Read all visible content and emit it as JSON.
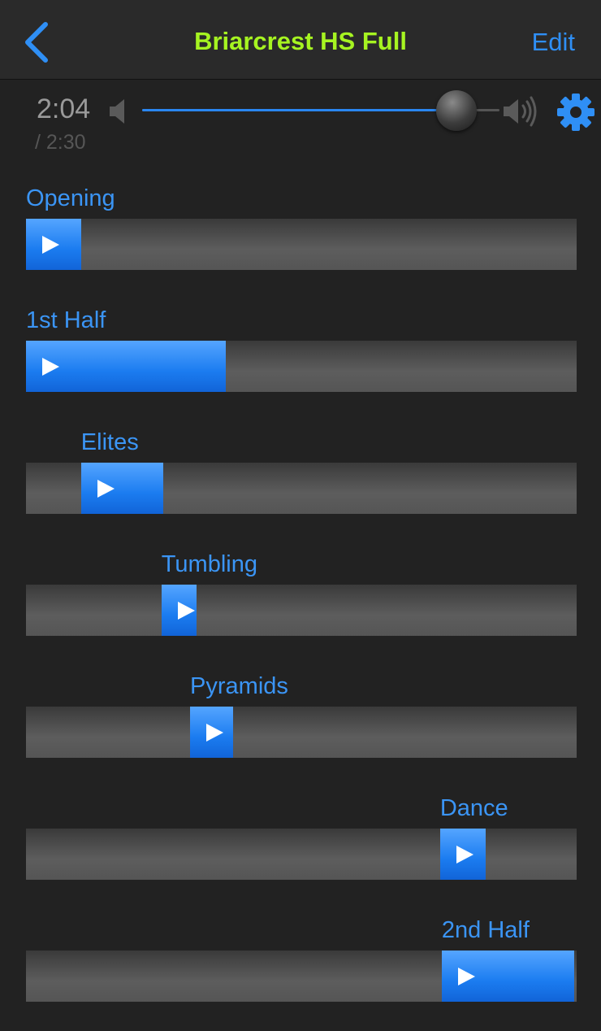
{
  "nav": {
    "back_icon": "chevron-left-icon",
    "title": "Briarcrest HS Full",
    "edit_label": "Edit",
    "title_color": "#a6f421",
    "accent_color": "#2f8ff5"
  },
  "transport": {
    "current_time": "2:04",
    "total_time": "/ 2:30",
    "volume_level": 0.88,
    "volume_low_icon": "volume-low-icon",
    "volume_high_icon": "volume-high-icon",
    "settings_icon": "gear-icon"
  },
  "sections": [
    {
      "label": "Opening",
      "clip_start": 0.0,
      "clip_end": 0.1
    },
    {
      "label": "1st Half",
      "clip_start": 0.0,
      "clip_end": 0.363
    },
    {
      "label": "Elites",
      "clip_start": 0.1,
      "clip_end": 0.25
    },
    {
      "label": "Tumbling",
      "clip_start": 0.246,
      "clip_end": 0.31
    },
    {
      "label": "Pyramids",
      "clip_start": 0.298,
      "clip_end": 0.376
    },
    {
      "label": "Dance",
      "clip_start": 0.752,
      "clip_end": 0.835
    },
    {
      "label": "2nd Half",
      "clip_start": 0.755,
      "clip_end": 0.995
    }
  ]
}
